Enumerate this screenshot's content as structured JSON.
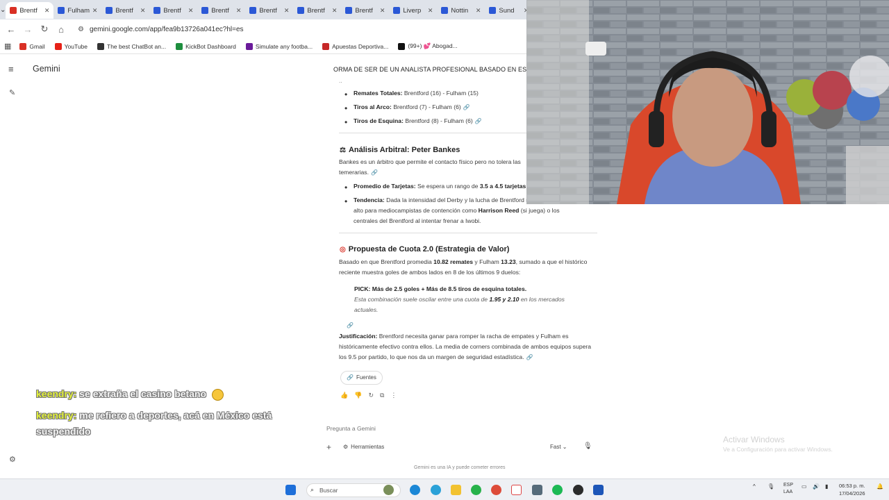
{
  "browser": {
    "tabs": [
      {
        "label": "Brentf",
        "color": "#d93025"
      },
      {
        "label": "Fulham",
        "color": "#2b58d6"
      },
      {
        "label": "Brentf",
        "color": "#2b58d6"
      },
      {
        "label": "Brentf",
        "color": "#2b58d6"
      },
      {
        "label": "Brentf",
        "color": "#2b58d6"
      },
      {
        "label": "Brentf",
        "color": "#2b58d6"
      },
      {
        "label": "Brentf",
        "color": "#2b58d6"
      },
      {
        "label": "Brentf",
        "color": "#2b58d6"
      },
      {
        "label": "Liverp",
        "color": "#2b58d6"
      },
      {
        "label": "Nottin",
        "color": "#2b58d6"
      },
      {
        "label": "Sund",
        "color": "#2b58d6"
      }
    ],
    "url": "gemini.google.com/app/fea9b13726a041ec?hl=es",
    "bookmarks": [
      {
        "label": "Gmail",
        "color": "#d93025"
      },
      {
        "label": "YouTube",
        "color": "#e62117"
      },
      {
        "label": "The best ChatBot an...",
        "color": "#333333"
      },
      {
        "label": "KickBot Dashboard",
        "color": "#1e8e3e"
      },
      {
        "label": "Simulate any footba...",
        "color": "#6a1b9a"
      },
      {
        "label": "Apuestas Deportiva...",
        "color": "#c62828"
      },
      {
        "label": "(99+) 💕 Abogad...",
        "color": "#111111"
      }
    ]
  },
  "gemini": {
    "title": "Gemini",
    "trunc_heading": "ORMA DE SER DE UN ANALISTA PROFESIONAL BASADO EN ESTADIST",
    "stats": [
      {
        "label": "Remates Totales:",
        "text": "Brentford (16) - Fulham (15)"
      },
      {
        "label": "Tiros al Arco:",
        "text": "Brentford (7) - Fulham (6)"
      },
      {
        "label": "Tiros de Esquina:",
        "text": "Brentford (8) - Fulham (6)"
      }
    ],
    "referee": {
      "heading": "Análisis Arbitral: Peter Bankes",
      "intro": "Bankes es un árbitro que permite el contacto físico pero no tolera las temerarias.",
      "bullet1_label": "Promedio de Tarjetas:",
      "bullet1_text": "Se espera un rango de",
      "bullet1_bold": "3.5 a 4.5 tarjetas",
      "bullet2_label": "Tendencia:",
      "bullet2_text": "Dada la intensidad del Derby y la lucha de Brentford riesgo de tarjeta es alto para mediocampistas de contención como",
      "bullet2_bold": "Harrison Reed",
      "bullet2_tail": "(si juega) o los centrales del Brentford al intentar frenar a Iwobi."
    },
    "proposal": {
      "heading": "Propuesta de Cuota 2.0 (Estrategia de Valor)",
      "p1_a": "Basado en que Brentford promedia",
      "p1_b": "10.82 remates",
      "p1_c": "y Fulham",
      "p1_d": "13.23",
      "p1_e": ", sumado a que el histórico reciente muestra goles de ambos lados en 8 de los últimos 9 duelos:",
      "pick": "PICK: Más de 2.5 goles + Más de 8.5 tiros de esquina totales.",
      "pick_note_a": "Esta combinación suele oscilar entre una cuota de",
      "pick_note_b": "1.95 y 2.10",
      "pick_note_c": "en los mercados actuales.",
      "just_label": "Justificación:",
      "just_text": "Brentford necesita ganar para romper la racha de empates y Fulham es históricamente efectivo contra ellos. La media de corners combinada de ambos equipos supera los 9.5 por partido, lo que nos da un margen de seguridad estadística."
    },
    "sources_label": "Fuentes",
    "prompt_placeholder": "Pregunta a Gemini",
    "tools_label": "Herramientas",
    "model_label": "Fast",
    "disclaimer": "Gemini es una IA y puede cometer errores"
  },
  "overlay": {
    "chat": [
      {
        "user": "keendry:",
        "text": "se extraña el casino betano"
      },
      {
        "user": "keendry:",
        "text": "me refiero a deportes, acá en México está suspendido"
      }
    ],
    "activate_title": "Activar Windows",
    "activate_sub": "Ve a Configuración para activar Windows."
  },
  "taskbar": {
    "search_placeholder": "Buscar",
    "lang_1": "ESP",
    "lang_2": "LAA",
    "time": "06:53 p. m.",
    "date": "17/04/2026"
  }
}
